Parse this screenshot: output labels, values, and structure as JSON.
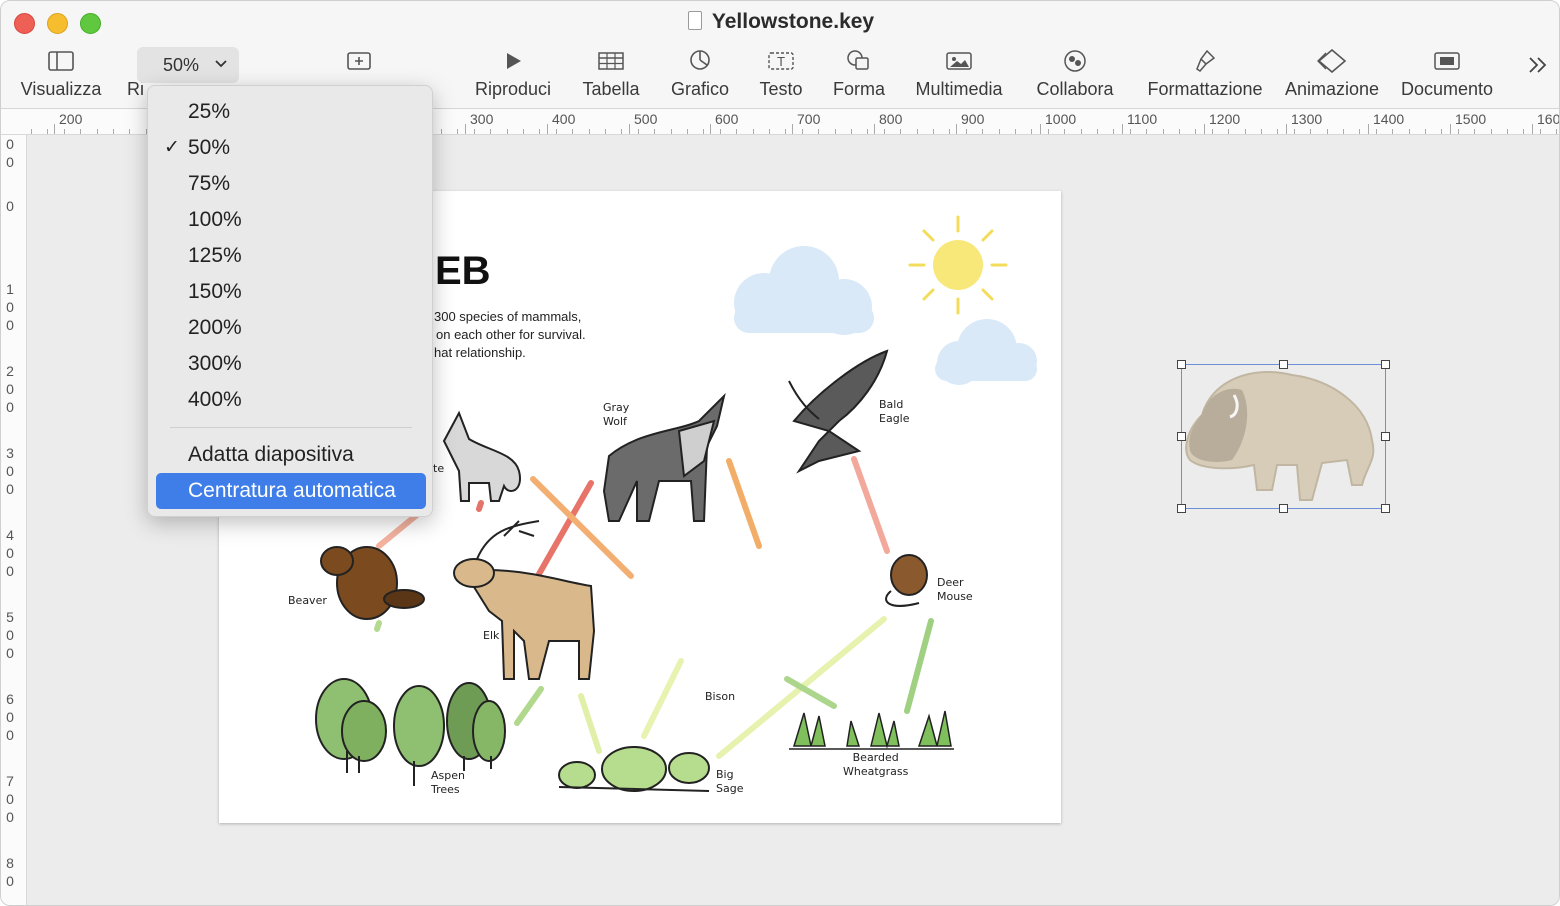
{
  "window": {
    "title": "Yellowstone.key"
  },
  "toolbar": {
    "zoom_value": "50%",
    "items": [
      {
        "label": "Visualizza",
        "icon": "sidebar-icon"
      },
      {
        "label": "Ri",
        "icon": "none"
      },
      {
        "label": "",
        "icon": "add-slide-icon"
      },
      {
        "label": "Riproduci",
        "icon": "play-icon"
      },
      {
        "label": "Tabella",
        "icon": "table-icon"
      },
      {
        "label": "Grafico",
        "icon": "chart-icon"
      },
      {
        "label": "Testo",
        "icon": "textbox-icon"
      },
      {
        "label": "Forma",
        "icon": "shape-icon"
      },
      {
        "label": "Multimedia",
        "icon": "media-icon"
      },
      {
        "label": "Collabora",
        "icon": "collaborate-icon"
      },
      {
        "label": "Formattazione",
        "icon": "format-brush-icon"
      },
      {
        "label": "Animazione",
        "icon": "animate-icon"
      },
      {
        "label": "Documento",
        "icon": "document-icon"
      }
    ],
    "overflow_icon": "chevron-double-right-icon"
  },
  "ruler_top": [
    "200",
    "300",
    "400",
    "500",
    "600",
    "700",
    "800",
    "900",
    "1000",
    "1100",
    "1200",
    "1300",
    "1400",
    "1500",
    "160"
  ],
  "ruler_left": [
    "0",
    "0",
    "0",
    "1",
    "0",
    "0",
    "2",
    "0",
    "0",
    "3",
    "0",
    "0",
    "4",
    "0",
    "0",
    "5",
    "0",
    "0",
    "6",
    "0",
    "0",
    "7",
    "0",
    "0",
    "8",
    "0"
  ],
  "zoom_menu": {
    "items": [
      {
        "label": "25%",
        "checked": false
      },
      {
        "label": "50%",
        "checked": true
      },
      {
        "label": "75%",
        "checked": false
      },
      {
        "label": "100%",
        "checked": false
      },
      {
        "label": "125%",
        "checked": false
      },
      {
        "label": "150%",
        "checked": false
      },
      {
        "label": "200%",
        "checked": false
      },
      {
        "label": "300%",
        "checked": false
      },
      {
        "label": "400%",
        "checked": false
      }
    ],
    "fit_label": "Adatta diapositiva",
    "center_label": "Centratura automatica",
    "check_mark": "✓"
  },
  "slide": {
    "title_visible": "EB",
    "body_lines": [
      "300 species of mammals,",
      "on each other for survival.",
      "hat relationship."
    ],
    "labels": {
      "coyote_partial": "te",
      "gray_wolf": "Gray\nWolf",
      "bald_eagle": "Bald\nEagle",
      "beaver": "Beaver",
      "elk": "Elk",
      "deer_mouse": "Deer\nMouse",
      "bison": "Bison",
      "aspen_trees": "Aspen\nTrees",
      "big_sage": "Big\nSage",
      "bearded_wheatgrass": "Bearded\nWheatgrass"
    }
  }
}
